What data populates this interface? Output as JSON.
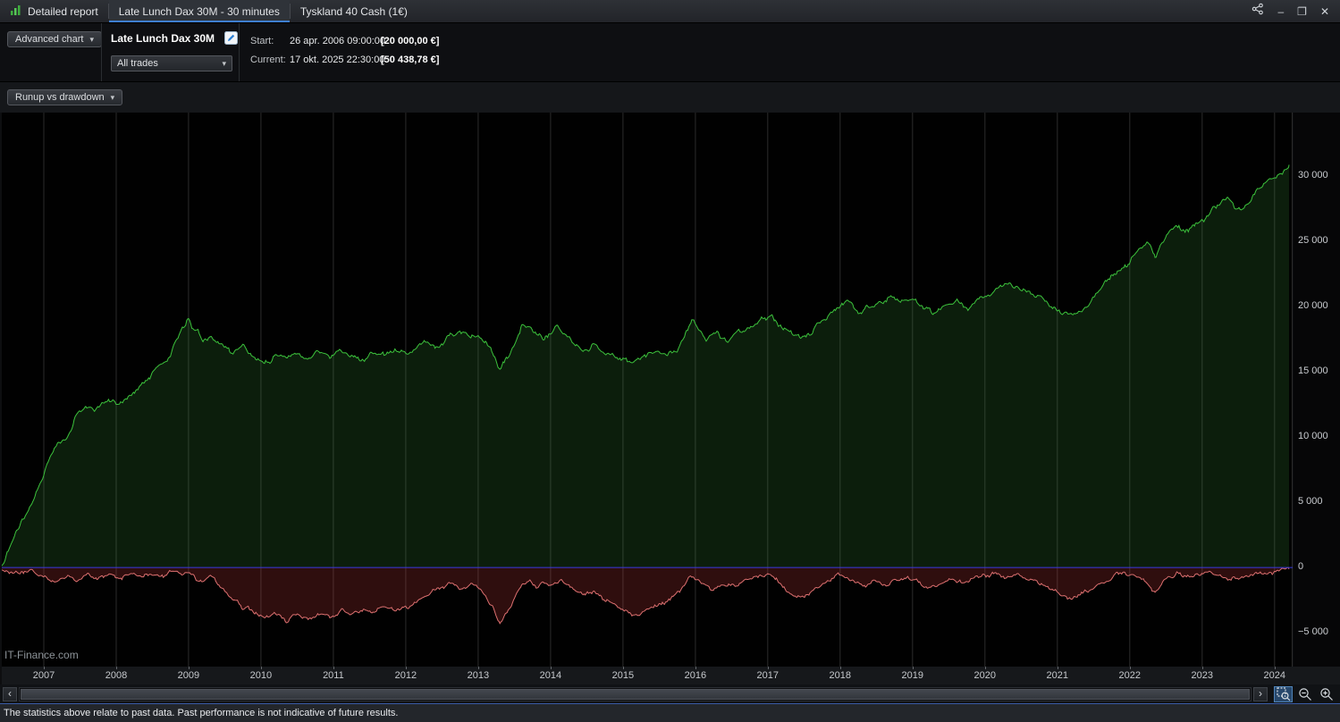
{
  "titlebar": {
    "tabs": [
      {
        "label": "Detailed report"
      },
      {
        "label": "Late Lunch Dax 30M - 30 minutes"
      },
      {
        "label": "Tyskland 40 Cash (1€)"
      }
    ]
  },
  "icons": {
    "caret": "▾",
    "minimize": "–",
    "maximize": "❐",
    "close": "✕",
    "scroll_left": "‹",
    "scroll_right": "›"
  },
  "toolbar": {
    "advanced_chart_label": "Advanced chart",
    "strategy_name": "Late Lunch Dax 30M",
    "trades_filter": "All trades",
    "start_label": "Start:",
    "start_datetime": "26 apr. 2006 09:00:00",
    "start_value": "[20 000,00 €]",
    "current_label": "Current:",
    "current_datetime": "17 okt. 2025 22:30:00",
    "current_value": "[50 438,78 €]"
  },
  "chart_controls": {
    "view_selector": "Runup vs drawdown"
  },
  "watermark": "IT-Finance.com",
  "statusbar": {
    "text": "The statistics above relate to past data. Past performance is not indicative of future results."
  },
  "colors": {
    "runup_line": "#3cc23c",
    "runup_fill": "rgba(60,150,60,0.20)",
    "drawdown_line": "#dd7070",
    "drawdown_fill": "rgba(195,58,58,0.24)",
    "zero_line": "#3a3ae0",
    "grid": "#2c2c2c",
    "tab_accent": "#3f7fd0"
  },
  "chart_data": {
    "type": "area",
    "title": "Runup vs drawdown",
    "xlim": [
      2006.42,
      2024.25
    ],
    "ylim": [
      -7600,
      34900
    ],
    "x_ticks": [
      2007,
      2008,
      2009,
      2010,
      2011,
      2012,
      2013,
      2014,
      2015,
      2016,
      2017,
      2018,
      2019,
      2020,
      2021,
      2022,
      2023,
      2024
    ],
    "y_ticks": [
      {
        "v": 30000,
        "label": "30 000"
      },
      {
        "v": 25000,
        "label": "25 000"
      },
      {
        "v": 20000,
        "label": "20 000"
      },
      {
        "v": 15000,
        "label": "15 000"
      },
      {
        "v": 10000,
        "label": "10 000"
      },
      {
        "v": 5000,
        "label": "5 000"
      },
      {
        "v": 0,
        "label": "0"
      },
      {
        "v": -5000,
        "label": "−5 000"
      }
    ],
    "grid": "vertical-only",
    "zero_line": 0,
    "series": [
      {
        "name": "Runup",
        "color": "#3cc23c",
        "fill": "rgba(60,150,60,0.20)",
        "points": [
          [
            2006.42,
            100
          ],
          [
            2006.55,
            1800
          ],
          [
            2006.7,
            3600
          ],
          [
            2006.85,
            5200
          ],
          [
            2007.0,
            7200
          ],
          [
            2007.1,
            8600
          ],
          [
            2007.2,
            9400
          ],
          [
            2007.3,
            9800
          ],
          [
            2007.45,
            11600
          ],
          [
            2007.55,
            12400
          ],
          [
            2007.7,
            12100
          ],
          [
            2007.85,
            12900
          ],
          [
            2008.0,
            12500
          ],
          [
            2008.15,
            12900
          ],
          [
            2008.3,
            13600
          ],
          [
            2008.45,
            14500
          ],
          [
            2008.6,
            15400
          ],
          [
            2008.75,
            16300
          ],
          [
            2008.9,
            18200
          ],
          [
            2009.0,
            18900
          ],
          [
            2009.1,
            18300
          ],
          [
            2009.2,
            17400
          ],
          [
            2009.3,
            17800
          ],
          [
            2009.45,
            17100
          ],
          [
            2009.6,
            16600
          ],
          [
            2009.75,
            17000
          ],
          [
            2009.9,
            16200
          ],
          [
            2010.05,
            15600
          ],
          [
            2010.2,
            16300
          ],
          [
            2010.35,
            15900
          ],
          [
            2010.5,
            16500
          ],
          [
            2010.65,
            16100
          ],
          [
            2010.8,
            16600
          ],
          [
            2010.95,
            16200
          ],
          [
            2011.1,
            16700
          ],
          [
            2011.25,
            16300
          ],
          [
            2011.4,
            16000
          ],
          [
            2011.55,
            16500
          ],
          [
            2011.7,
            16200
          ],
          [
            2011.85,
            16700
          ],
          [
            2012.0,
            16400
          ],
          [
            2012.15,
            16900
          ],
          [
            2012.3,
            17300
          ],
          [
            2012.45,
            17000
          ],
          [
            2012.6,
            17700
          ],
          [
            2012.75,
            18100
          ],
          [
            2012.9,
            17700
          ],
          [
            2013.0,
            17900
          ],
          [
            2013.1,
            17300
          ],
          [
            2013.2,
            16500
          ],
          [
            2013.3,
            15300
          ],
          [
            2013.4,
            16200
          ],
          [
            2013.5,
            17200
          ],
          [
            2013.6,
            18300
          ],
          [
            2013.7,
            18600
          ],
          [
            2013.8,
            18000
          ],
          [
            2013.9,
            17600
          ],
          [
            2014.0,
            18000
          ],
          [
            2014.1,
            18400
          ],
          [
            2014.2,
            17800
          ],
          [
            2014.3,
            17200
          ],
          [
            2014.45,
            16600
          ],
          [
            2014.6,
            17100
          ],
          [
            2014.75,
            16500
          ],
          [
            2014.9,
            16200
          ],
          [
            2015.0,
            15900
          ],
          [
            2015.15,
            15600
          ],
          [
            2015.3,
            16100
          ],
          [
            2015.45,
            16500
          ],
          [
            2015.6,
            16200
          ],
          [
            2015.75,
            16800
          ],
          [
            2015.85,
            17800
          ],
          [
            2015.95,
            18900
          ],
          [
            2016.05,
            18200
          ],
          [
            2016.15,
            17600
          ],
          [
            2016.3,
            17900
          ],
          [
            2016.45,
            17500
          ],
          [
            2016.6,
            18000
          ],
          [
            2016.75,
            18400
          ],
          [
            2016.9,
            18900
          ],
          [
            2017.0,
            19400
          ],
          [
            2017.1,
            18900
          ],
          [
            2017.2,
            18400
          ],
          [
            2017.35,
            17900
          ],
          [
            2017.5,
            17600
          ],
          [
            2017.65,
            18300
          ],
          [
            2017.8,
            19000
          ],
          [
            2017.95,
            19900
          ],
          [
            2018.1,
            20400
          ],
          [
            2018.25,
            19700
          ],
          [
            2018.4,
            19900
          ],
          [
            2018.55,
            20300
          ],
          [
            2018.7,
            20800
          ],
          [
            2018.85,
            20300
          ],
          [
            2019.0,
            20600
          ],
          [
            2019.15,
            19900
          ],
          [
            2019.3,
            19600
          ],
          [
            2019.45,
            20100
          ],
          [
            2019.6,
            20400
          ],
          [
            2019.75,
            20000
          ],
          [
            2019.9,
            20500
          ],
          [
            2020.05,
            20900
          ],
          [
            2020.2,
            21400
          ],
          [
            2020.35,
            21800
          ],
          [
            2020.5,
            21300
          ],
          [
            2020.65,
            21000
          ],
          [
            2020.8,
            20500
          ],
          [
            2020.95,
            20000
          ],
          [
            2021.1,
            19600
          ],
          [
            2021.25,
            19300
          ],
          [
            2021.4,
            19900
          ],
          [
            2021.5,
            20700
          ],
          [
            2021.65,
            21800
          ],
          [
            2021.8,
            22600
          ],
          [
            2021.95,
            23200
          ],
          [
            2022.05,
            23900
          ],
          [
            2022.15,
            24500
          ],
          [
            2022.25,
            25000
          ],
          [
            2022.35,
            23800
          ],
          [
            2022.45,
            24800
          ],
          [
            2022.55,
            25600
          ],
          [
            2022.65,
            26100
          ],
          [
            2022.75,
            25700
          ],
          [
            2022.85,
            26200
          ],
          [
            2022.95,
            26500
          ],
          [
            2023.05,
            26900
          ],
          [
            2023.15,
            27400
          ],
          [
            2023.25,
            27900
          ],
          [
            2023.35,
            28300
          ],
          [
            2023.45,
            27700
          ],
          [
            2023.55,
            27400
          ],
          [
            2023.65,
            28200
          ],
          [
            2023.75,
            28800
          ],
          [
            2023.85,
            29300
          ],
          [
            2023.95,
            29600
          ],
          [
            2024.05,
            29900
          ],
          [
            2024.12,
            30200
          ],
          [
            2024.2,
            30900
          ]
        ]
      },
      {
        "name": "Drawdown",
        "color": "#dd7070",
        "fill": "rgba(195,58,58,0.24)",
        "points": [
          [
            2006.42,
            -150
          ],
          [
            2006.6,
            -400
          ],
          [
            2006.8,
            -250
          ],
          [
            2007.0,
            -800
          ],
          [
            2007.15,
            -1200
          ],
          [
            2007.3,
            -600
          ],
          [
            2007.45,
            -1000
          ],
          [
            2007.6,
            -500
          ],
          [
            2007.75,
            -900
          ],
          [
            2007.9,
            -600
          ],
          [
            2008.05,
            -1000
          ],
          [
            2008.2,
            -500
          ],
          [
            2008.35,
            -800
          ],
          [
            2008.5,
            -400
          ],
          [
            2008.65,
            -700
          ],
          [
            2008.8,
            -300
          ],
          [
            2009.0,
            -500
          ],
          [
            2009.15,
            -1000
          ],
          [
            2009.3,
            -700
          ],
          [
            2009.45,
            -1500
          ],
          [
            2009.6,
            -2400
          ],
          [
            2009.75,
            -3000
          ],
          [
            2009.9,
            -3400
          ],
          [
            2010.05,
            -3900
          ],
          [
            2010.2,
            -3500
          ],
          [
            2010.35,
            -4100
          ],
          [
            2010.5,
            -3700
          ],
          [
            2010.65,
            -4000
          ],
          [
            2010.8,
            -3600
          ],
          [
            2010.95,
            -3800
          ],
          [
            2011.1,
            -3300
          ],
          [
            2011.25,
            -3600
          ],
          [
            2011.4,
            -3200
          ],
          [
            2011.55,
            -3500
          ],
          [
            2011.7,
            -3000
          ],
          [
            2011.85,
            -3300
          ],
          [
            2012.0,
            -3100
          ],
          [
            2012.15,
            -2600
          ],
          [
            2012.3,
            -2100
          ],
          [
            2012.45,
            -1600
          ],
          [
            2012.6,
            -1100
          ],
          [
            2012.75,
            -1700
          ],
          [
            2012.9,
            -1300
          ],
          [
            2013.0,
            -1600
          ],
          [
            2013.1,
            -2200
          ],
          [
            2013.2,
            -3000
          ],
          [
            2013.3,
            -4400
          ],
          [
            2013.4,
            -3400
          ],
          [
            2013.5,
            -2500
          ],
          [
            2013.6,
            -1400
          ],
          [
            2013.7,
            -900
          ],
          [
            2013.8,
            -1400
          ],
          [
            2013.9,
            -1100
          ],
          [
            2014.0,
            -1500
          ],
          [
            2014.15,
            -1000
          ],
          [
            2014.3,
            -1600
          ],
          [
            2014.45,
            -2100
          ],
          [
            2014.6,
            -1800
          ],
          [
            2014.75,
            -2400
          ],
          [
            2014.9,
            -2900
          ],
          [
            2015.05,
            -3400
          ],
          [
            2015.2,
            -3800
          ],
          [
            2015.35,
            -3300
          ],
          [
            2015.5,
            -2900
          ],
          [
            2015.65,
            -2400
          ],
          [
            2015.8,
            -1600
          ],
          [
            2015.95,
            -700
          ],
          [
            2016.1,
            -1300
          ],
          [
            2016.25,
            -1700
          ],
          [
            2016.4,
            -1200
          ],
          [
            2016.55,
            -1500
          ],
          [
            2016.7,
            -1100
          ],
          [
            2016.85,
            -800
          ],
          [
            2017.0,
            -500
          ],
          [
            2017.15,
            -1200
          ],
          [
            2017.3,
            -1900
          ],
          [
            2017.45,
            -2300
          ],
          [
            2017.6,
            -1900
          ],
          [
            2017.75,
            -1300
          ],
          [
            2017.9,
            -800
          ],
          [
            2018.05,
            -500
          ],
          [
            2018.2,
            -1100
          ],
          [
            2018.35,
            -1400
          ],
          [
            2018.5,
            -1000
          ],
          [
            2018.65,
            -1300
          ],
          [
            2018.8,
            -900
          ],
          [
            2018.95,
            -700
          ],
          [
            2019.1,
            -1100
          ],
          [
            2019.25,
            -1600
          ],
          [
            2019.4,
            -1200
          ],
          [
            2019.55,
            -900
          ],
          [
            2019.7,
            -1200
          ],
          [
            2019.85,
            -900
          ],
          [
            2020.0,
            -600
          ],
          [
            2020.15,
            -400
          ],
          [
            2020.3,
            -700
          ],
          [
            2020.45,
            -500
          ],
          [
            2020.6,
            -800
          ],
          [
            2020.75,
            -1200
          ],
          [
            2020.9,
            -1600
          ],
          [
            2021.05,
            -2000
          ],
          [
            2021.2,
            -2400
          ],
          [
            2021.35,
            -2000
          ],
          [
            2021.5,
            -1500
          ],
          [
            2021.65,
            -1000
          ],
          [
            2021.8,
            -600
          ],
          [
            2021.95,
            -350
          ],
          [
            2022.1,
            -700
          ],
          [
            2022.25,
            -1300
          ],
          [
            2022.35,
            -2000
          ],
          [
            2022.5,
            -700
          ],
          [
            2022.65,
            -450
          ],
          [
            2022.8,
            -700
          ],
          [
            2022.95,
            -500
          ],
          [
            2023.1,
            -350
          ],
          [
            2023.25,
            -600
          ],
          [
            2023.4,
            -950
          ],
          [
            2023.55,
            -700
          ],
          [
            2023.7,
            -500
          ],
          [
            2023.85,
            -350
          ],
          [
            2024.0,
            -300
          ],
          [
            2024.1,
            -200
          ],
          [
            2024.2,
            -120
          ]
        ]
      }
    ]
  }
}
